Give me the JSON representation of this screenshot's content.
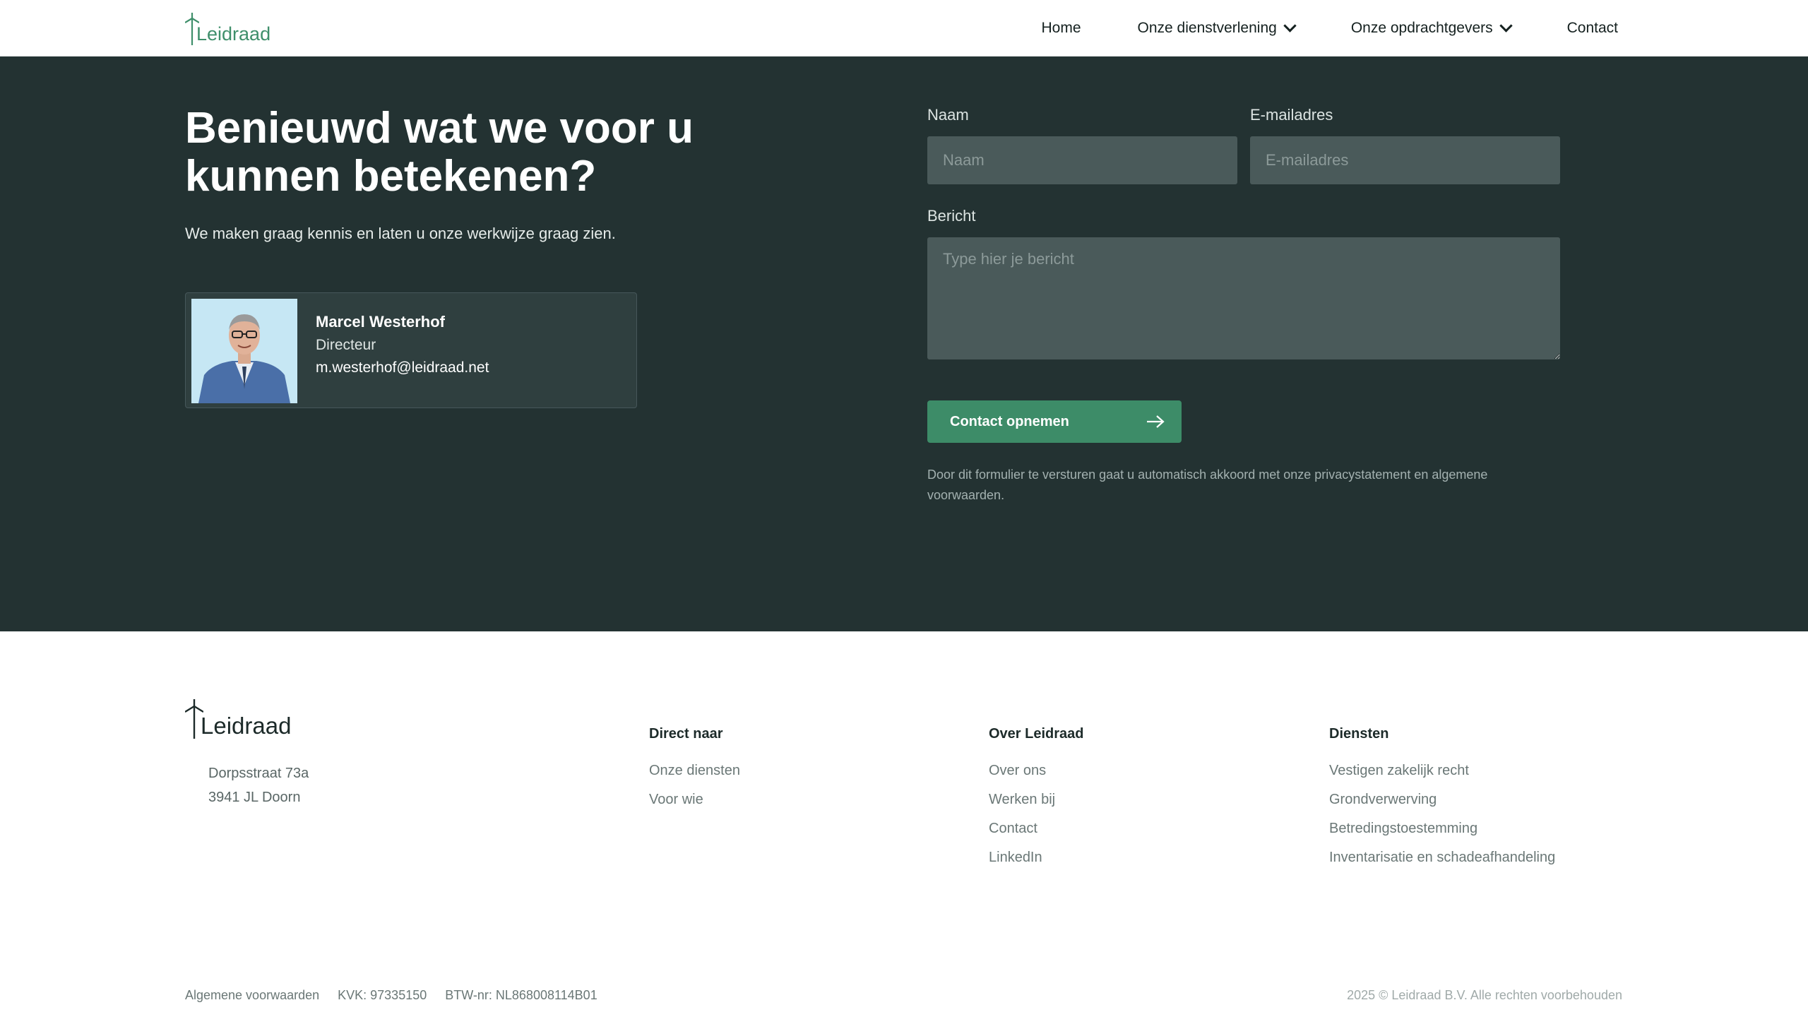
{
  "header": {
    "logo_text": "Leidraad",
    "nav": [
      {
        "label": "Home"
      },
      {
        "label": "Onze dienstverlening"
      },
      {
        "label": "Onze opdrachtgevers"
      },
      {
        "label": "Contact"
      }
    ]
  },
  "hero": {
    "title": "Benieuwd wat we voor u kunnen betekenen?",
    "subtitle": "We maken graag kennis en laten u onze werkwijze graag zien.",
    "contact_person": {
      "name": "Marcel Westerhof",
      "role": "Directeur",
      "email": "m.westerhof@leidraad.net"
    }
  },
  "form": {
    "name_label": "Naam",
    "name_placeholder": "Naam",
    "email_label": "E-mailadres",
    "email_placeholder": "E-mailadres",
    "message_label": "Bericht",
    "message_placeholder": "Type hier je bericht",
    "submit_label": "Contact opnemen",
    "disclaimer": "Door dit formulier te versturen gaat u automatisch akkoord met onze privacystatement en algemene voorwaarden."
  },
  "footer": {
    "logo_text": "Leidraad",
    "address_line1": "Dorpsstraat 73a",
    "address_line2": "3941 JL Doorn",
    "columns": [
      {
        "title": "Direct naar",
        "links": [
          "Onze diensten",
          "Voor wie"
        ]
      },
      {
        "title": "Over Leidraad",
        "links": [
          "Over ons",
          "Werken bij",
          "Contact",
          "LinkedIn"
        ]
      },
      {
        "title": "Diensten",
        "links": [
          "Vestigen zakelijk recht",
          "Grondverwerving",
          "Betredingstoestemming",
          "Inventarisatie en schadeafhandeling"
        ]
      }
    ],
    "bottom": {
      "terms": "Algemene voorwaarden",
      "kvk": "KVK: 97335150",
      "btw": "BTW-nr: NL868008114B01",
      "copyright": "2025 © Leidraad B.V. Alle rechten voorbehouden"
    }
  },
  "colors": {
    "brand_green": "#3d8c68",
    "dark_section": "#233232",
    "card_bg": "#2f3f3f",
    "input_bg": "#4a5a5a"
  },
  "icons": {
    "logo": "wind-turbine-icon",
    "dropdown": "chevron-down-icon",
    "submit": "arrow-right-icon",
    "photo": "person-photo"
  }
}
